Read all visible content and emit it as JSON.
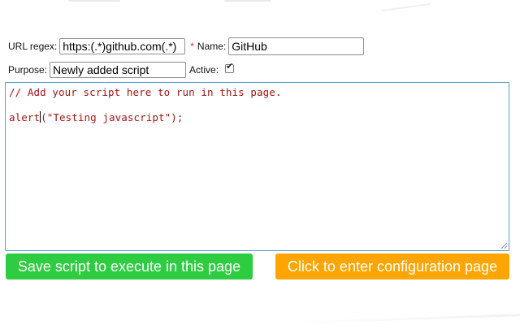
{
  "form": {
    "url_label": "URL regex:",
    "url_value": "https:(.*)github.com(.*)",
    "required_mark": "*",
    "name_label": "Name:",
    "name_value": "GitHub",
    "purpose_label": "Purpose:",
    "purpose_value": "Newly added script",
    "active_label": "Active:",
    "active_checked": true,
    "check_glyph": "✔"
  },
  "editor": {
    "line1": "// Add your script here to run in this page.",
    "line2_before_caret": "alert",
    "line2_after_caret": "(\"Testing javascript\");"
  },
  "buttons": {
    "save_label": "Save script to execute in this page",
    "config_label": "Click to enter configuration page"
  },
  "colors": {
    "save_bg": "#2ecc40",
    "config_bg": "#ffa500",
    "required": "#e0302a",
    "code_text": "#a31515",
    "editor_border": "#5b9bd5"
  }
}
